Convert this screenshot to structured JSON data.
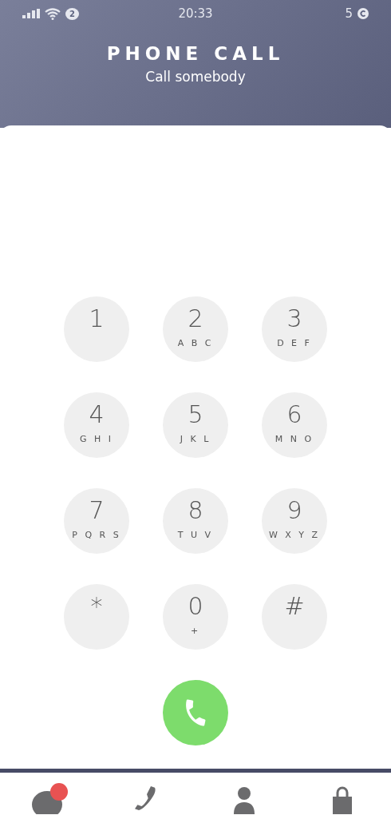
{
  "status_bar": {
    "message_count": "2",
    "time": "20:33",
    "coins": "5"
  },
  "header": {
    "title": "PHONE CALL",
    "subtitle": "Call somebody"
  },
  "keypad": [
    {
      "digit": "1"
    },
    {
      "digit": "2",
      "letters": "A B C"
    },
    {
      "digit": "3",
      "letters": "D E F"
    },
    {
      "digit": "4",
      "letters": "G H I"
    },
    {
      "digit": "5",
      "letters": "J K L"
    },
    {
      "digit": "6",
      "letters": "M N O"
    },
    {
      "digit": "7",
      "letters": "P Q R S"
    },
    {
      "digit": "8",
      "letters": "T U V"
    },
    {
      "digit": "9",
      "letters": "W X Y Z"
    },
    {
      "digit": "*"
    },
    {
      "digit": "0",
      "letters": "+"
    },
    {
      "digit": "#"
    }
  ],
  "nav": [
    {
      "kind": "chat",
      "notification": true
    },
    {
      "kind": "phone",
      "notification": false
    },
    {
      "kind": "person",
      "notification": false
    },
    {
      "kind": "bag",
      "notification": false
    }
  ]
}
